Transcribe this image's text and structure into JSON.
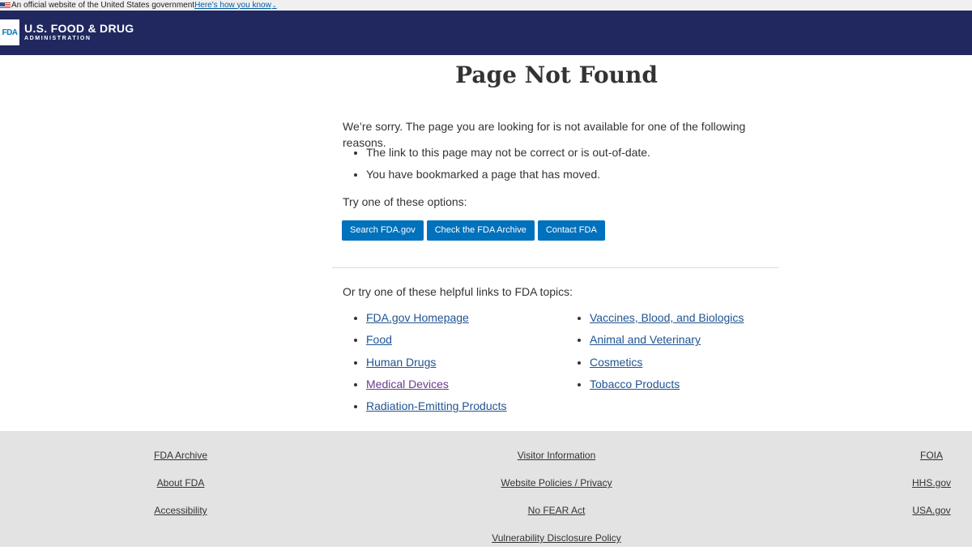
{
  "gov_banner": {
    "text": "An official website of the United States government",
    "link": "Here's how you know",
    "flag_icon": "us-flag-icon",
    "caret_icon": "chevron-down-icon"
  },
  "header": {
    "logo_mark": "FDA",
    "title": "U.S. FOOD & DRUG",
    "subtitle": "ADMINISTRATION",
    "background_color": "#20285f"
  },
  "main": {
    "title": "Page Not Found",
    "sorry_text": "We’re sorry. The page you are looking for is not available for one of the following reasons.",
    "reasons": [
      "The link to this page may not be correct or is out-of-date.",
      "You have bookmarked a page that has moved."
    ],
    "options_text": "Try one of these options:",
    "buttons": [
      "Search FDA.gov",
      "Check the FDA Archive",
      "Contact FDA"
    ],
    "button_color": "#0071bc",
    "helpful_text": "Or try one of these helpful links to FDA topics:",
    "topics_left": [
      {
        "label": "FDA.gov Homepage",
        "visited": false
      },
      {
        "label": "Food",
        "visited": false
      },
      {
        "label": "Human Drugs",
        "visited": false
      },
      {
        "label": "Medical Devices",
        "visited": true
      },
      {
        "label": "Radiation-Emitting Products",
        "visited": false
      }
    ],
    "topics_right": [
      {
        "label": "Vaccines, Blood, and Biologics",
        "visited": false
      },
      {
        "label": "Animal and Veterinary",
        "visited": false
      },
      {
        "label": "Cosmetics",
        "visited": false
      },
      {
        "label": "Tobacco Products",
        "visited": false
      }
    ]
  },
  "footer": {
    "col1": [
      "FDA Archive",
      "About FDA",
      "Accessibility"
    ],
    "col2": [
      "Visitor Information",
      "Website Policies / Privacy",
      "No FEAR Act",
      "Vulnerability Disclosure Policy"
    ],
    "col3": [
      "FOIA",
      "HHS.gov",
      "USA.gov"
    ]
  }
}
